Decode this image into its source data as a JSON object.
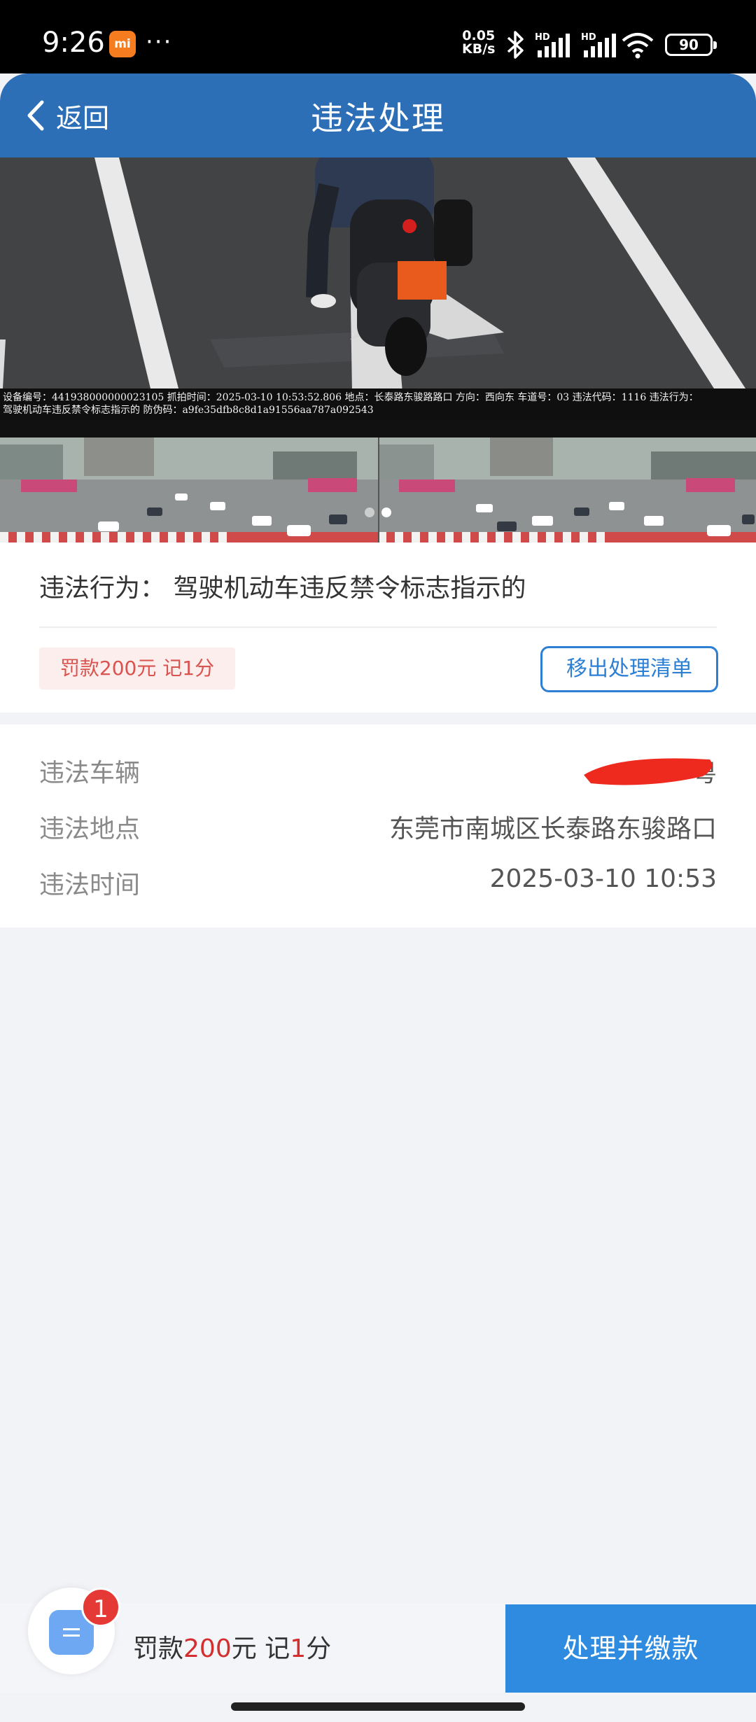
{
  "status_bar": {
    "time": "9:26",
    "app_icon": "mi",
    "more": "···",
    "net_speed_value": "0.05",
    "net_speed_unit": "KB/s",
    "signal_1": "HD",
    "signal_2": "HD",
    "battery": "90"
  },
  "header": {
    "back_label": "返回",
    "title": "违法处理"
  },
  "photo": {
    "caption_line1": "设备编号：441938000000023105 抓拍时间：2025-03-10 10:53:52.806 地点：长泰路东骏路路口 方向：西向东 车道号：03 违法代码：1116 违法行为：",
    "caption_line2": "驾驶机动车违反禁令标志指示的 防伪码：a9fe35dfb8c8d1a91556aa787a092543",
    "dots_count": 2,
    "active_dot": 2
  },
  "violation": {
    "behavior_text": "违法行为：  驾驶机动车违反禁令标志指示的",
    "penalty_tag": "罚款200元 记1分",
    "remove_button": "移出处理清单"
  },
  "details": {
    "vehicle_label": "违法车辆",
    "vehicle_value": "粤",
    "location_label": "违法地点",
    "location_value": "东莞市南城区长泰路东骏路口",
    "time_label": "违法时间",
    "time_value": "2025-03-10 10:53"
  },
  "bottom": {
    "badge_count": "1",
    "fine_prefix": "罚款",
    "fine_amount": "200",
    "fine_mid": "元 记",
    "points": "1",
    "points_suffix": "分",
    "pay_button": "处理并缴款"
  },
  "colors": {
    "header_blue": "#2c6fb7",
    "accent_blue": "#2d7fd3",
    "penalty_red": "#d9534f",
    "pay_blue": "#2e8be0",
    "badge_red": "#e53935"
  }
}
